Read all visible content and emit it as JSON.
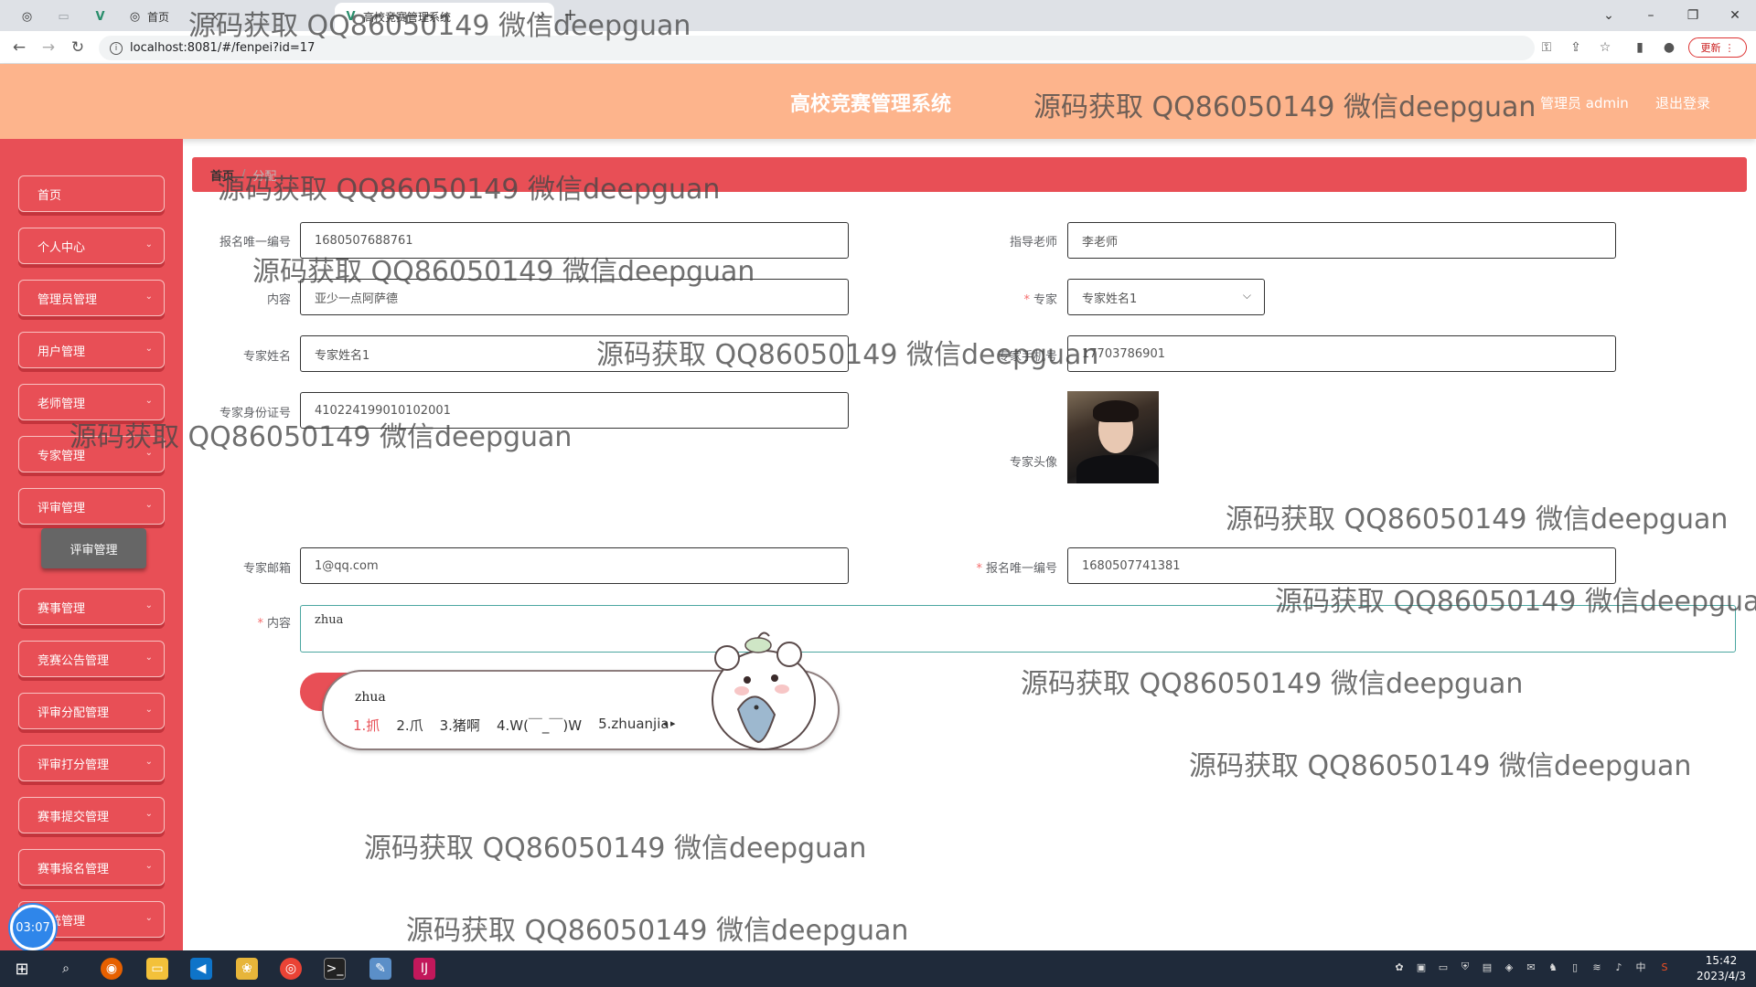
{
  "browser": {
    "tabs": [
      {
        "label": ""
      },
      {
        "label": ""
      },
      {
        "label": ""
      },
      {
        "label": "首页"
      },
      {
        "label": "高校竞赛管理系统"
      }
    ],
    "url": "localhost:8081/#/fenpei?id=17",
    "update_label": "更新"
  },
  "header": {
    "title": "高校竞赛管理系统",
    "admin": "管理员 admin",
    "logout": "退出登录"
  },
  "sidebar": {
    "items": [
      {
        "label": "首页",
        "has_chevron": false
      },
      {
        "label": "个人中心",
        "has_chevron": true
      },
      {
        "label": "管理员管理",
        "has_chevron": true
      },
      {
        "label": "用户管理",
        "has_chevron": true
      },
      {
        "label": "老师管理",
        "has_chevron": true
      },
      {
        "label": "专家管理",
        "has_chevron": true
      },
      {
        "label": "评审管理",
        "has_chevron": true
      },
      {
        "label": "赛事管理",
        "has_chevron": true
      },
      {
        "label": "竞赛公告管理",
        "has_chevron": true
      },
      {
        "label": "评审分配管理",
        "has_chevron": true
      },
      {
        "label": "评审打分管理",
        "has_chevron": true
      },
      {
        "label": "赛事提交管理",
        "has_chevron": true
      },
      {
        "label": "赛事报名管理",
        "has_chevron": true
      },
      {
        "label": "系统管理",
        "has_chevron": true
      }
    ],
    "submenu_label": "评审管理",
    "timer": "03:07"
  },
  "breadcrumb": {
    "home": "首页",
    "sep": "/",
    "current": "分配"
  },
  "form": {
    "baoming_id_label": "报名唯一编号",
    "baoming_id_value": "1680507688761",
    "teacher_label": "指导老师",
    "teacher_value": "李老师",
    "content_label": "内容",
    "content_value": "亚少一点阿萨德",
    "expert_label": "专家",
    "expert_value": "专家姓名1",
    "expert_name_label": "专家姓名",
    "expert_name_value": "专家姓名1",
    "expert_phone_label": "专家手机号",
    "expert_phone_value": "17703786901",
    "expert_idcard_label": "专家身份证号",
    "expert_idcard_value": "410224199010102001",
    "expert_avatar_label": "专家头像",
    "expert_email_label": "专家邮箱",
    "expert_email_value": "1@qq.com",
    "baoming_id2_label": "报名唯一编号",
    "baoming_id2_value": "1680507741381",
    "content2_label": "内容",
    "content2_value": "zhua"
  },
  "ime": {
    "composition": "zhua",
    "candidates": [
      "1.抓",
      "2.爪",
      "3.猪啊",
      "4.W(￣_￣)W",
      "5.zhuanjia"
    ]
  },
  "watermark": "源码获取 QQ86050149 微信deepguan",
  "taskbar": {
    "time": "15:42",
    "date": "2023/4/3",
    "ime_indicator": "中"
  }
}
